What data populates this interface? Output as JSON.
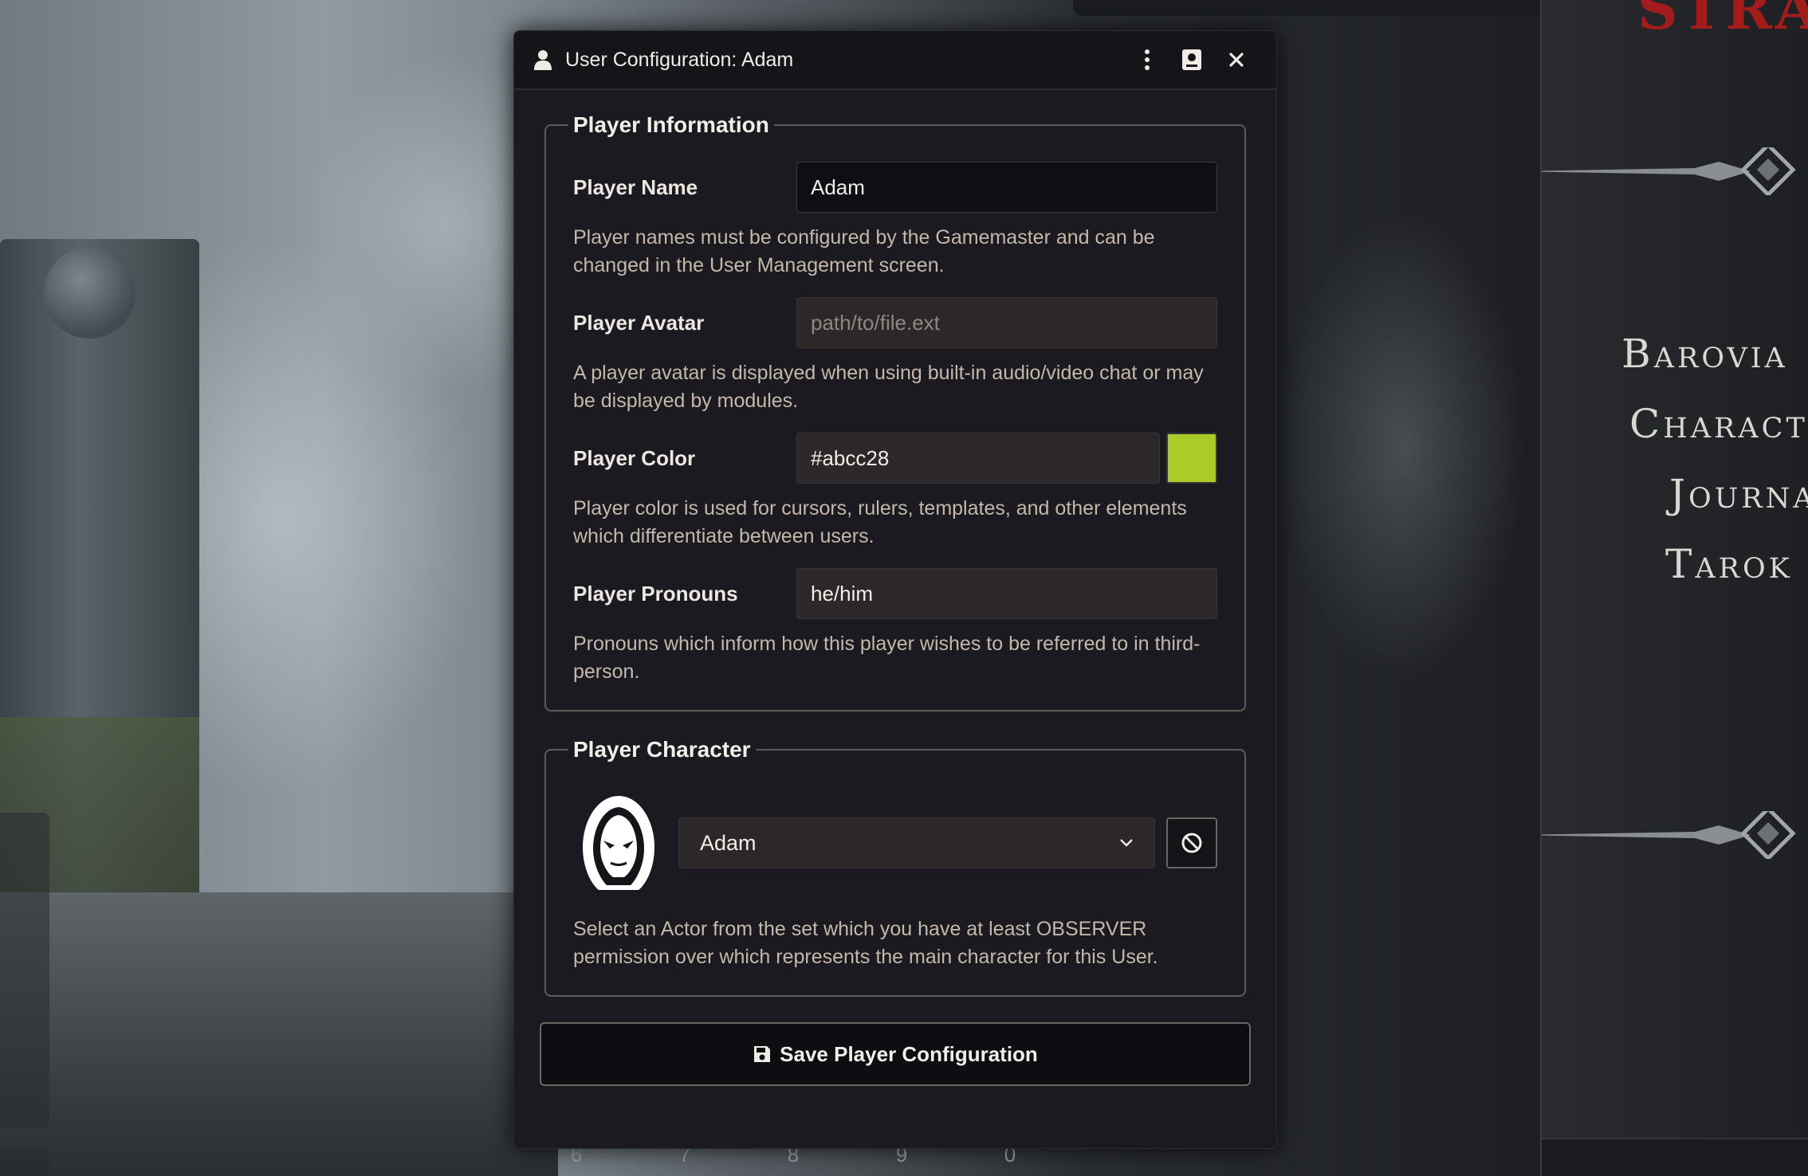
{
  "window": {
    "title": "User Configuration: Adam",
    "header_icons": [
      "user-icon",
      "kebab-menu-icon",
      "sheet-config-icon",
      "close-icon"
    ]
  },
  "player_information": {
    "legend": "Player Information",
    "name": {
      "label": "Player Name",
      "value": "Adam",
      "hint": "Player names must be configured by the Gamemaster and can be changed in the User Management screen."
    },
    "avatar": {
      "label": "Player Avatar",
      "placeholder": "path/to/file.ext",
      "hint": "A player avatar is displayed when using built-in audio/video chat or may be displayed by modules."
    },
    "color": {
      "label": "Player Color",
      "value": "#abcc28",
      "swatch": "#abcc28",
      "hint": "Player color is used for cursors, rulers, templates, and other elements which differentiate between users."
    },
    "pronouns": {
      "label": "Player Pronouns",
      "value": "he/him",
      "hint": "Pronouns which inform how this player wishes to be referred to in third-person."
    }
  },
  "player_character": {
    "legend": "Player Character",
    "selected": "Adam",
    "hint": "Select an Actor from the set which you have at least OBSERVER permission over which represents the main character for this User."
  },
  "save_button": {
    "label": "Save Player Configuration",
    "icon": "save-icon"
  },
  "sidebar": {
    "brand": "STRA",
    "items": [
      "Barovia",
      "Charact",
      "Journa",
      "Tarok"
    ]
  },
  "hotbar": {
    "slots": [
      "6",
      "7",
      "8",
      "9",
      "0"
    ]
  },
  "colors": {
    "dialog_bg": "#1b1a20",
    "accent_text": "#c4b8ab",
    "brand_red": "#a31c1c"
  }
}
